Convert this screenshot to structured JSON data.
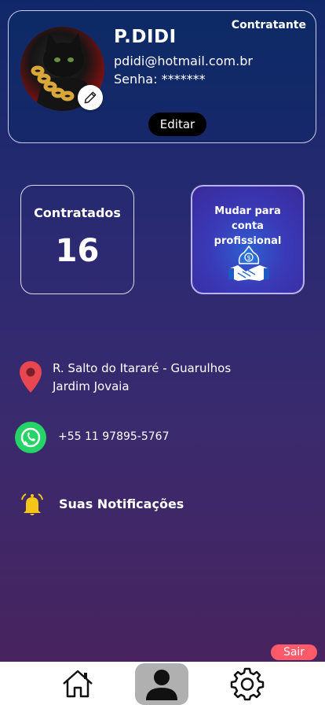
{
  "profile": {
    "role": "Contratante",
    "name": "P.DIDI",
    "email": "pdidi@hotmail.com.br",
    "password_label": "Senha: *******",
    "edit_button": "Editar",
    "avatar_icon": "cat-photo",
    "edit_photo_icon": "pencil-icon"
  },
  "stats": {
    "label": "Contratados",
    "value": "16"
  },
  "switch_account": {
    "label": "Mudar para conta profissional",
    "icon": "handshake-money-icon"
  },
  "address": {
    "line1": "R. Salto do Itararé - Guarulhos",
    "line2": "Jardim Jovaia",
    "icon": "location-pin-icon"
  },
  "contact": {
    "phone": "+55 11 97895-5767",
    "icon": "whatsapp-icon"
  },
  "notifications": {
    "label": "Suas Notificações",
    "icon": "bell-icon"
  },
  "logout_label": "Sair",
  "nav": {
    "items": [
      "home-icon",
      "profile-icon",
      "settings-icon"
    ],
    "active": "profile-icon"
  },
  "colors": {
    "accent_logout": "#ff5a6a",
    "pin": "#e8474f",
    "whatsapp": "#25d366",
    "bell": "#f5c518"
  }
}
